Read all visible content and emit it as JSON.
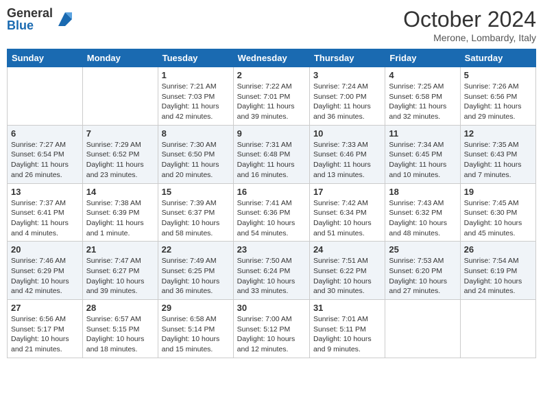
{
  "logo": {
    "general": "General",
    "blue": "Blue"
  },
  "title": "October 2024",
  "location": "Merone, Lombardy, Italy",
  "days_of_week": [
    "Sunday",
    "Monday",
    "Tuesday",
    "Wednesday",
    "Thursday",
    "Friday",
    "Saturday"
  ],
  "weeks": [
    [
      {
        "day": "",
        "info": ""
      },
      {
        "day": "",
        "info": ""
      },
      {
        "day": "1",
        "info": "Sunrise: 7:21 AM\nSunset: 7:03 PM\nDaylight: 11 hours and 42 minutes."
      },
      {
        "day": "2",
        "info": "Sunrise: 7:22 AM\nSunset: 7:01 PM\nDaylight: 11 hours and 39 minutes."
      },
      {
        "day": "3",
        "info": "Sunrise: 7:24 AM\nSunset: 7:00 PM\nDaylight: 11 hours and 36 minutes."
      },
      {
        "day": "4",
        "info": "Sunrise: 7:25 AM\nSunset: 6:58 PM\nDaylight: 11 hours and 32 minutes."
      },
      {
        "day": "5",
        "info": "Sunrise: 7:26 AM\nSunset: 6:56 PM\nDaylight: 11 hours and 29 minutes."
      }
    ],
    [
      {
        "day": "6",
        "info": "Sunrise: 7:27 AM\nSunset: 6:54 PM\nDaylight: 11 hours and 26 minutes."
      },
      {
        "day": "7",
        "info": "Sunrise: 7:29 AM\nSunset: 6:52 PM\nDaylight: 11 hours and 23 minutes."
      },
      {
        "day": "8",
        "info": "Sunrise: 7:30 AM\nSunset: 6:50 PM\nDaylight: 11 hours and 20 minutes."
      },
      {
        "day": "9",
        "info": "Sunrise: 7:31 AM\nSunset: 6:48 PM\nDaylight: 11 hours and 16 minutes."
      },
      {
        "day": "10",
        "info": "Sunrise: 7:33 AM\nSunset: 6:46 PM\nDaylight: 11 hours and 13 minutes."
      },
      {
        "day": "11",
        "info": "Sunrise: 7:34 AM\nSunset: 6:45 PM\nDaylight: 11 hours and 10 minutes."
      },
      {
        "day": "12",
        "info": "Sunrise: 7:35 AM\nSunset: 6:43 PM\nDaylight: 11 hours and 7 minutes."
      }
    ],
    [
      {
        "day": "13",
        "info": "Sunrise: 7:37 AM\nSunset: 6:41 PM\nDaylight: 11 hours and 4 minutes."
      },
      {
        "day": "14",
        "info": "Sunrise: 7:38 AM\nSunset: 6:39 PM\nDaylight: 11 hours and 1 minute."
      },
      {
        "day": "15",
        "info": "Sunrise: 7:39 AM\nSunset: 6:37 PM\nDaylight: 10 hours and 58 minutes."
      },
      {
        "day": "16",
        "info": "Sunrise: 7:41 AM\nSunset: 6:36 PM\nDaylight: 10 hours and 54 minutes."
      },
      {
        "day": "17",
        "info": "Sunrise: 7:42 AM\nSunset: 6:34 PM\nDaylight: 10 hours and 51 minutes."
      },
      {
        "day": "18",
        "info": "Sunrise: 7:43 AM\nSunset: 6:32 PM\nDaylight: 10 hours and 48 minutes."
      },
      {
        "day": "19",
        "info": "Sunrise: 7:45 AM\nSunset: 6:30 PM\nDaylight: 10 hours and 45 minutes."
      }
    ],
    [
      {
        "day": "20",
        "info": "Sunrise: 7:46 AM\nSunset: 6:29 PM\nDaylight: 10 hours and 42 minutes."
      },
      {
        "day": "21",
        "info": "Sunrise: 7:47 AM\nSunset: 6:27 PM\nDaylight: 10 hours and 39 minutes."
      },
      {
        "day": "22",
        "info": "Sunrise: 7:49 AM\nSunset: 6:25 PM\nDaylight: 10 hours and 36 minutes."
      },
      {
        "day": "23",
        "info": "Sunrise: 7:50 AM\nSunset: 6:24 PM\nDaylight: 10 hours and 33 minutes."
      },
      {
        "day": "24",
        "info": "Sunrise: 7:51 AM\nSunset: 6:22 PM\nDaylight: 10 hours and 30 minutes."
      },
      {
        "day": "25",
        "info": "Sunrise: 7:53 AM\nSunset: 6:20 PM\nDaylight: 10 hours and 27 minutes."
      },
      {
        "day": "26",
        "info": "Sunrise: 7:54 AM\nSunset: 6:19 PM\nDaylight: 10 hours and 24 minutes."
      }
    ],
    [
      {
        "day": "27",
        "info": "Sunrise: 6:56 AM\nSunset: 5:17 PM\nDaylight: 10 hours and 21 minutes."
      },
      {
        "day": "28",
        "info": "Sunrise: 6:57 AM\nSunset: 5:15 PM\nDaylight: 10 hours and 18 minutes."
      },
      {
        "day": "29",
        "info": "Sunrise: 6:58 AM\nSunset: 5:14 PM\nDaylight: 10 hours and 15 minutes."
      },
      {
        "day": "30",
        "info": "Sunrise: 7:00 AM\nSunset: 5:12 PM\nDaylight: 10 hours and 12 minutes."
      },
      {
        "day": "31",
        "info": "Sunrise: 7:01 AM\nSunset: 5:11 PM\nDaylight: 10 hours and 9 minutes."
      },
      {
        "day": "",
        "info": ""
      },
      {
        "day": "",
        "info": ""
      }
    ]
  ]
}
